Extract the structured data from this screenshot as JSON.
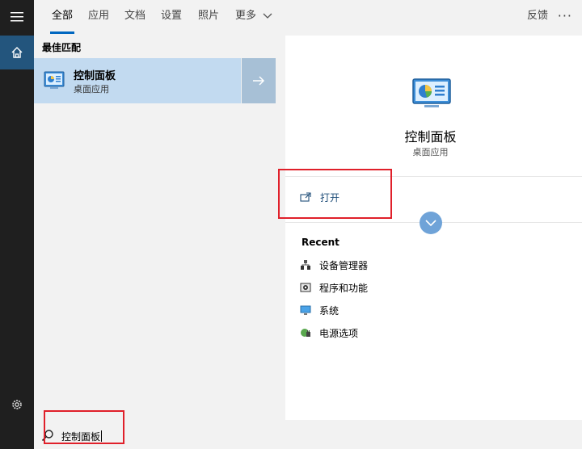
{
  "sidebar": {
    "menu_icon": "hamburger-icon",
    "home_icon": "home-icon",
    "settings_icon": "gear-icon"
  },
  "tabs": [
    {
      "label": "全部",
      "active": true
    },
    {
      "label": "应用"
    },
    {
      "label": "文档"
    },
    {
      "label": "设置"
    },
    {
      "label": "照片"
    },
    {
      "label": "更多"
    }
  ],
  "header": {
    "feedback_label": "反馈",
    "more_label": "···"
  },
  "best_match": {
    "section_title": "最佳匹配",
    "title": "控制面板",
    "subtitle": "桌面应用"
  },
  "detail": {
    "title": "控制面板",
    "subtitle": "桌面应用",
    "open_label": "打开",
    "recent_title": "Recent",
    "recent_items": [
      {
        "label": "设备管理器",
        "icon": "device-manager-icon"
      },
      {
        "label": "程序和功能",
        "icon": "programs-features-icon"
      },
      {
        "label": "系统",
        "icon": "system-monitor-icon"
      },
      {
        "label": "电源选项",
        "icon": "power-options-icon"
      }
    ]
  },
  "search": {
    "value": "控制面板"
  },
  "colors": {
    "accent": "#0067c0",
    "selection": "#c2daf0",
    "highlight": "#e0202a"
  }
}
